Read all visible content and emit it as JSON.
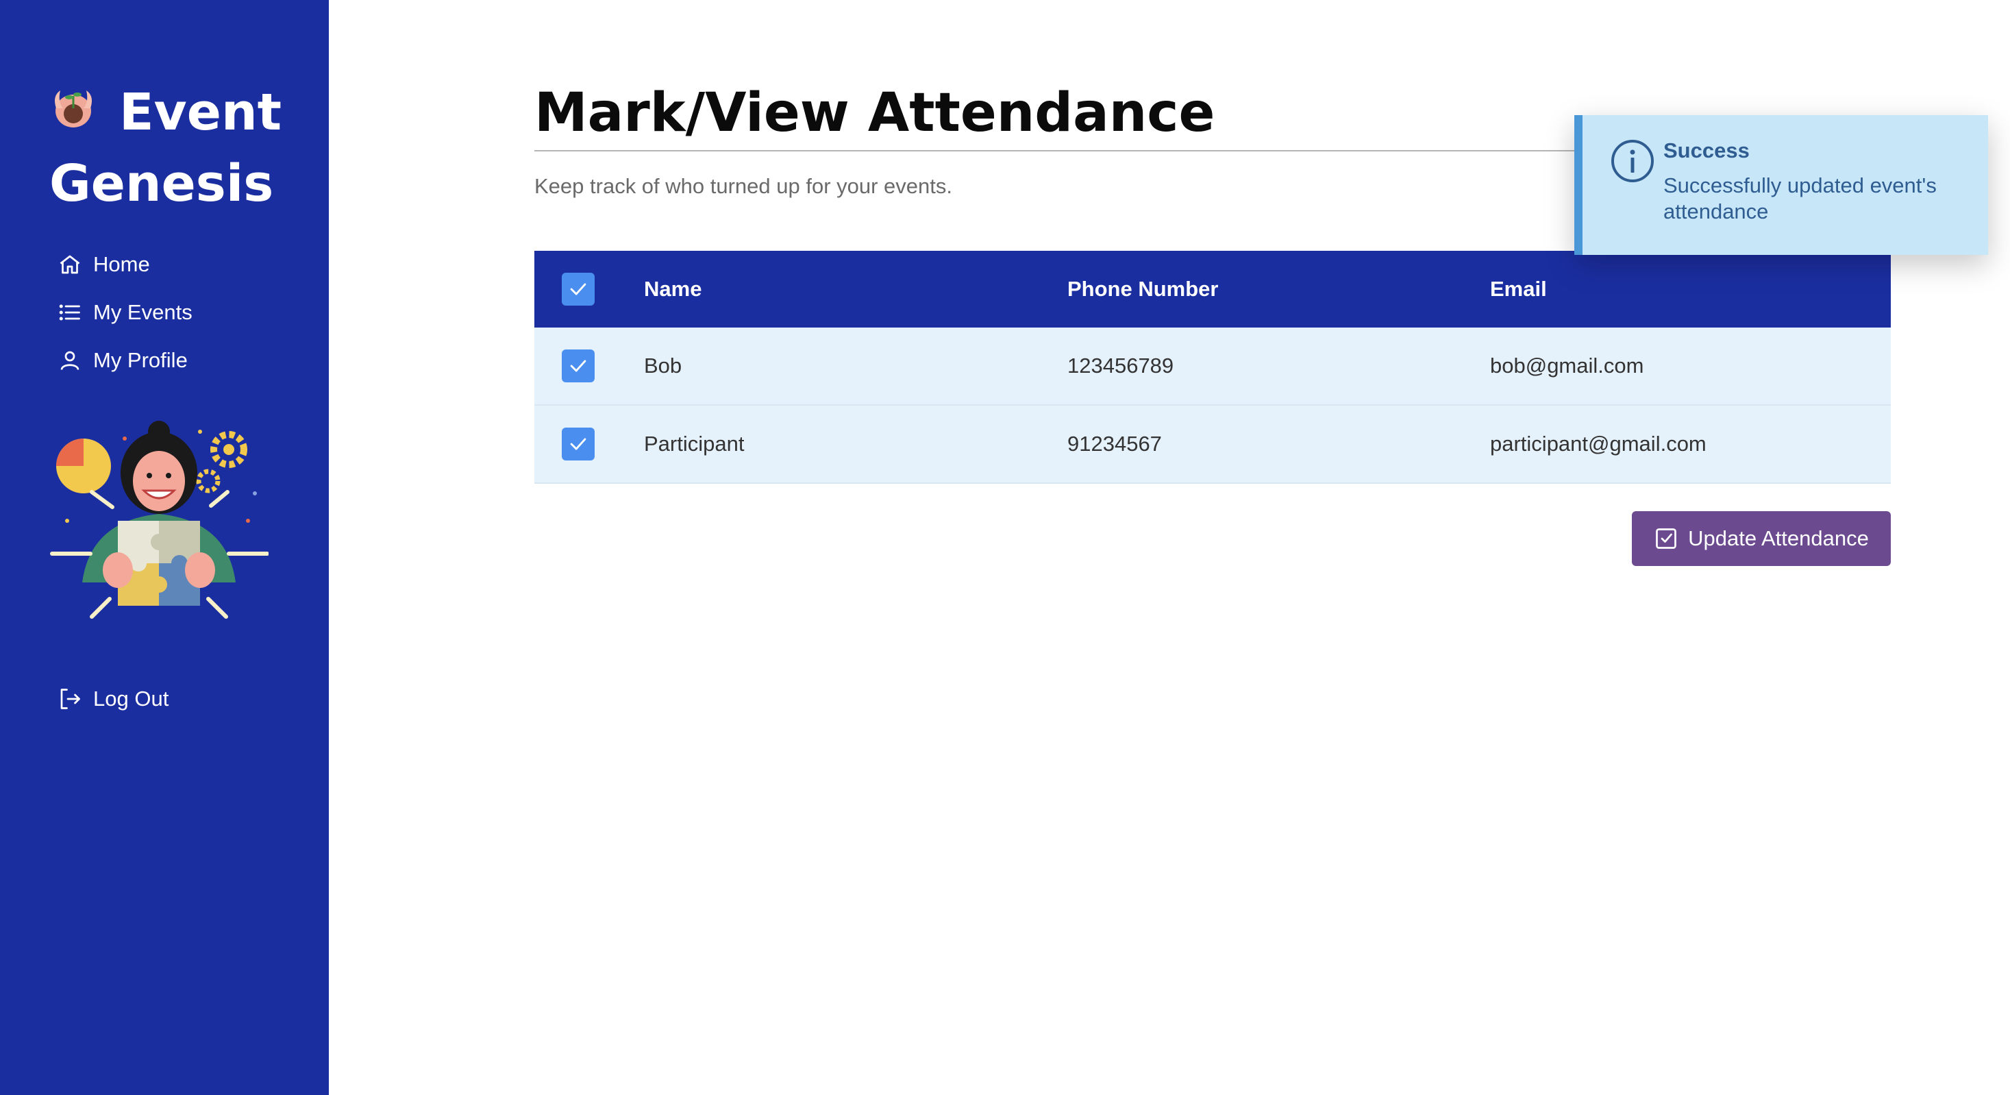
{
  "app": {
    "name_line1": "Event",
    "name_line2": "Genesis"
  },
  "sidebar": {
    "items": [
      {
        "label": "Home",
        "icon": "home-icon"
      },
      {
        "label": "My Events",
        "icon": "list-icon"
      },
      {
        "label": "My Profile",
        "icon": "user-icon"
      }
    ],
    "logout_label": "Log Out"
  },
  "main": {
    "title": "Mark/View Attendance",
    "subtitle": "Keep track of who turned up for your events.",
    "table": {
      "columns": [
        "Name",
        "Phone Number",
        "Email"
      ],
      "select_all_checked": true,
      "rows": [
        {
          "checked": true,
          "name": "Bob",
          "phone": "123456789",
          "email": "bob@gmail.com"
        },
        {
          "checked": true,
          "name": "Participant",
          "phone": "91234567",
          "email": "participant@gmail.com"
        }
      ]
    },
    "update_button_label": "Update Attendance"
  },
  "toast": {
    "title": "Success",
    "message": "Successfully updated event's attendance"
  },
  "colors": {
    "sidebar_bg": "#1b2ea0",
    "header_bg": "#1b2ea0",
    "row_bg": "#e5f1fb",
    "checkbox": "#4a8ff0",
    "button_bg": "#6b4a8f",
    "toast_bg": "#c7e6f8",
    "toast_accent": "#4a97d8"
  }
}
